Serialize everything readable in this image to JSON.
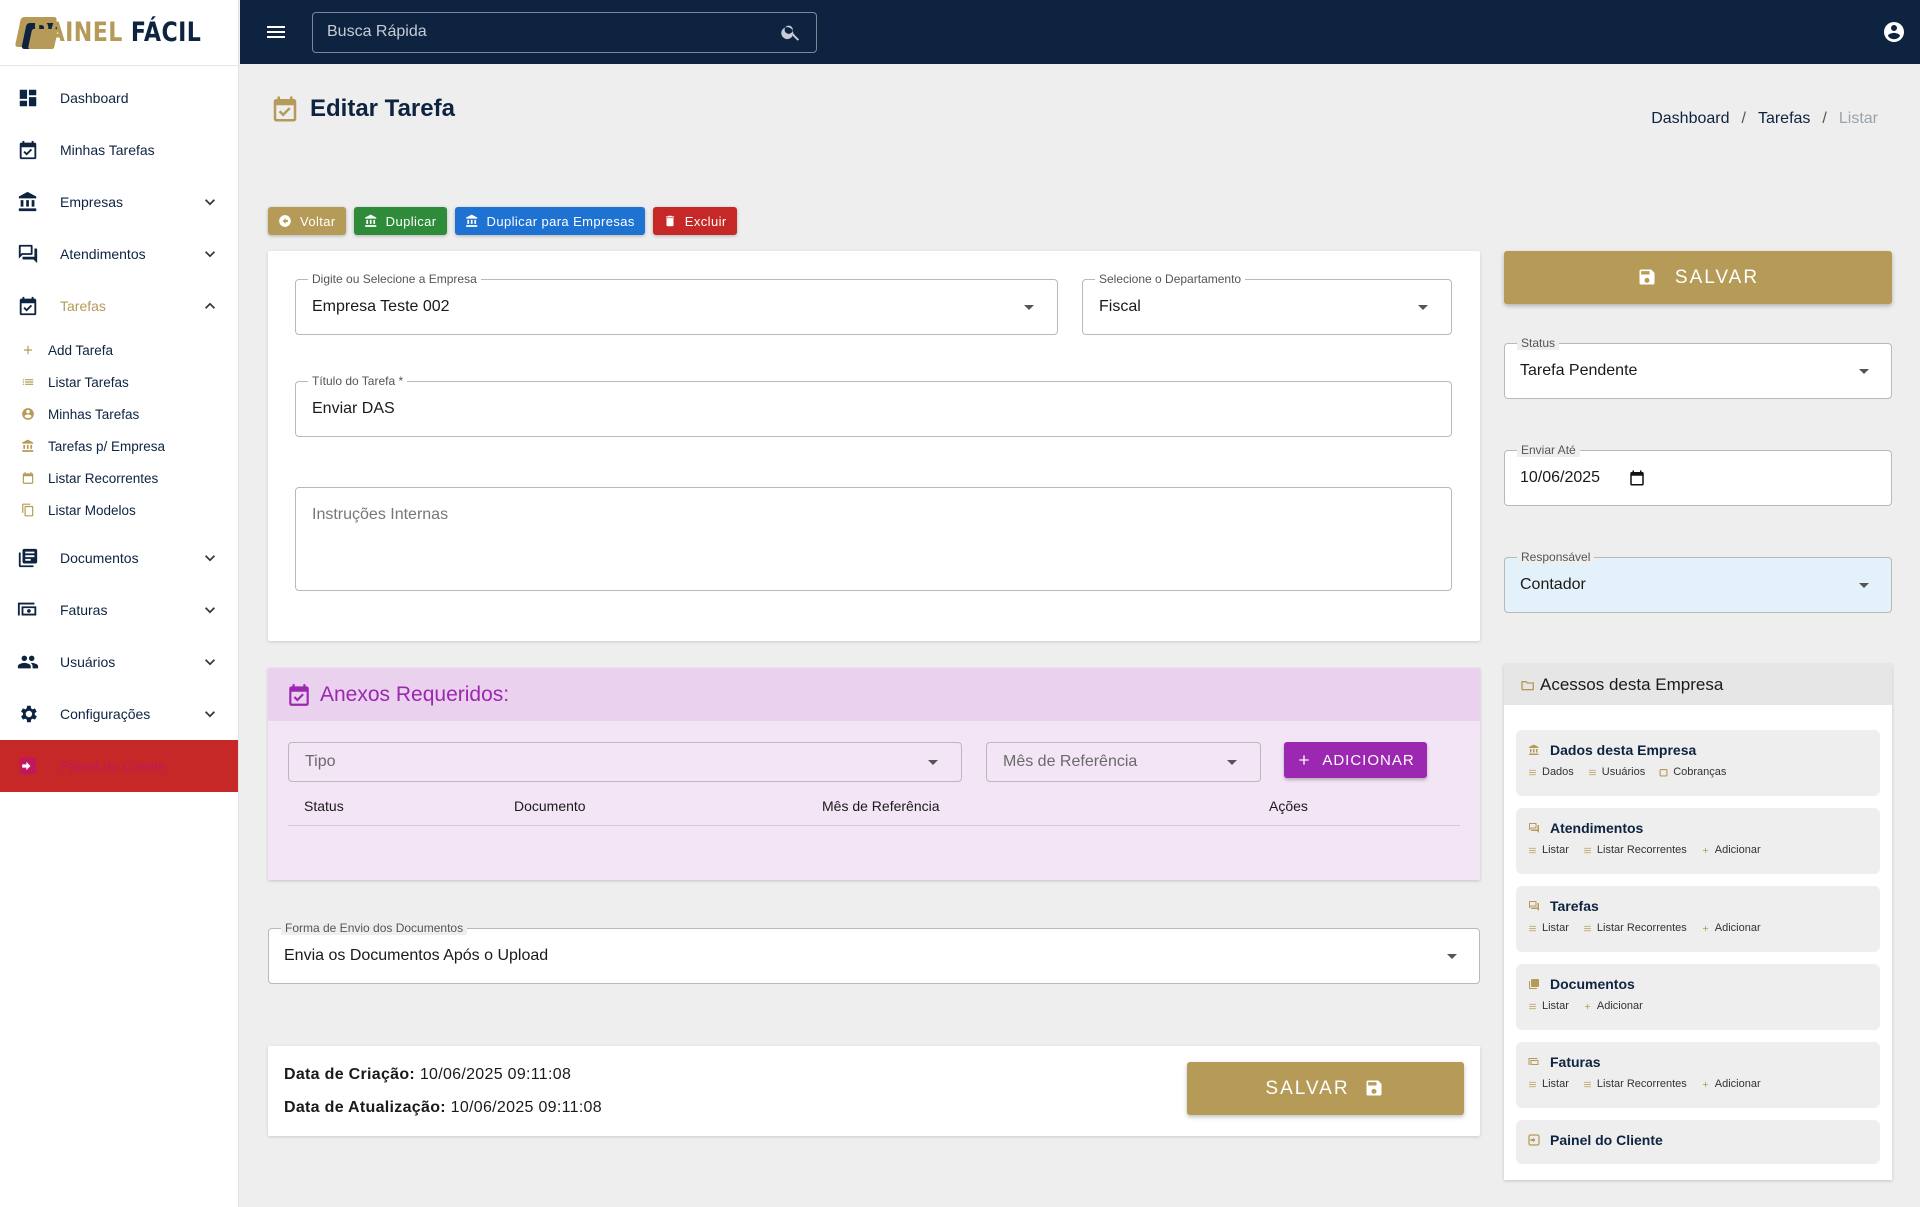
{
  "brand": {
    "part1": "PAINEL",
    "part2": "FÁCIL"
  },
  "search": {
    "placeholder": "Busca Rápida"
  },
  "sidebar": {
    "items": [
      {
        "label": "Dashboard"
      },
      {
        "label": "Minhas Tarefas"
      },
      {
        "label": "Empresas"
      },
      {
        "label": "Atendimentos"
      },
      {
        "label": "Tarefas"
      },
      {
        "label": "Documentos"
      },
      {
        "label": "Faturas"
      },
      {
        "label": "Usuários"
      },
      {
        "label": "Configurações"
      },
      {
        "label": "Painel do Cliente"
      }
    ],
    "tarefas_sub": [
      {
        "label": "Add Tarefa"
      },
      {
        "label": "Listar Tarefas"
      },
      {
        "label": "Minhas Tarefas"
      },
      {
        "label": "Tarefas p/ Empresa"
      },
      {
        "label": "Listar Recorrentes"
      },
      {
        "label": "Listar Modelos"
      }
    ]
  },
  "page": {
    "title": "Editar Tarefa"
  },
  "breadcrumb": {
    "items": [
      "Dashboard",
      "Tarefas",
      "Listar"
    ],
    "sep": "/"
  },
  "actions": {
    "voltar": "Voltar",
    "duplicar": "Duplicar",
    "duplicar_empresas": "Duplicar para Empresas",
    "excluir": "Excluir"
  },
  "form": {
    "empresa": {
      "label": "Digite ou Selecione a Empresa",
      "value": "Empresa Teste 002"
    },
    "departamento": {
      "label": "Selecione o Departamento",
      "value": "Fiscal"
    },
    "titulo": {
      "label": "Título do Tarefa *",
      "value": "Enviar DAS"
    },
    "instrucoes": {
      "placeholder": "Instruções Internas"
    }
  },
  "anexos": {
    "title": "Anexos Requeridos:",
    "tipo_placeholder": "Tipo",
    "mes_placeholder": "Mês de Referência",
    "add_label": "ADICIONAR",
    "columns": [
      "Status",
      "Documento",
      "Mês de Referência",
      "Ações"
    ]
  },
  "forma_envio": {
    "label": "Forma de Envio dos Documentos",
    "value": "Envia os Documentos Após o Upload"
  },
  "footer": {
    "criacao_label": "Data de Criação:",
    "criacao_value": "10/06/2025 09:11:08",
    "atualizacao_label": "Data de Atualização:",
    "atualizacao_value": "10/06/2025 09:11:08",
    "save_label": "SALVAR"
  },
  "right": {
    "save_label": "SALVAR",
    "status": {
      "label": "Status",
      "value": "Tarefa Pendente"
    },
    "enviar_ate": {
      "label": "Enviar Até",
      "value": "10/06/2025"
    },
    "responsavel": {
      "label": "Responsável",
      "value": "Contador"
    }
  },
  "acessos": {
    "title": "Acessos desta Empresa",
    "cards": [
      {
        "title": "Dados desta Empresa",
        "links": [
          "Dados",
          "Usuários",
          "Cobranças"
        ]
      },
      {
        "title": "Atendimentos",
        "links": [
          "Listar",
          "Listar Recorrentes",
          "Adicionar"
        ]
      },
      {
        "title": "Tarefas",
        "links": [
          "Listar",
          "Listar Recorrentes",
          "Adicionar"
        ]
      },
      {
        "title": "Documentos",
        "links": [
          "Listar",
          "Adicionar"
        ]
      },
      {
        "title": "Faturas",
        "links": [
          "Listar",
          "Listar Recorrentes",
          "Adicionar"
        ]
      },
      {
        "title": "Painel do Cliente",
        "links": []
      }
    ]
  },
  "colors": {
    "navy": "#0d2340",
    "gold": "#b59a58",
    "purple": "#9c27b0",
    "green": "#2e8b3a",
    "blue": "#1e73d2",
    "red": "#c62828"
  }
}
